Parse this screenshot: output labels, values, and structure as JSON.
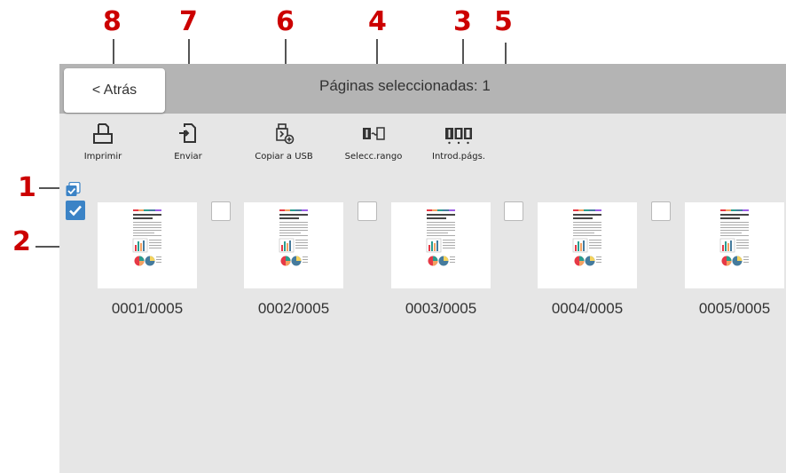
{
  "callouts": [
    "8",
    "7",
    "6",
    "4",
    "3",
    "5",
    "1",
    "2"
  ],
  "header": {
    "back_label": "< Atrás",
    "status_text": "Páginas seleccionadas: 1"
  },
  "toolbar": [
    {
      "label": "Imprimir",
      "icon": "print-icon"
    },
    {
      "label": "Enviar",
      "icon": "send-icon"
    },
    {
      "label": "Copiar a USB",
      "icon": "usb-copy-icon"
    },
    {
      "label": "Selecc.rango",
      "icon": "range-select-icon"
    },
    {
      "label": "Introd.págs.",
      "icon": "page-number-input-icon"
    }
  ],
  "pages": [
    {
      "label": "0001/0005",
      "selected": true
    },
    {
      "label": "0002/0005",
      "selected": false
    },
    {
      "label": "0003/0005",
      "selected": false
    },
    {
      "label": "0004/0005",
      "selected": false
    },
    {
      "label": "0005/0005",
      "selected": false
    }
  ],
  "colors": {
    "callout": "#cc0000",
    "checkbox_checked": "#3b83c6",
    "header": "#b4b4b4",
    "screen": "#e6e6e6"
  }
}
